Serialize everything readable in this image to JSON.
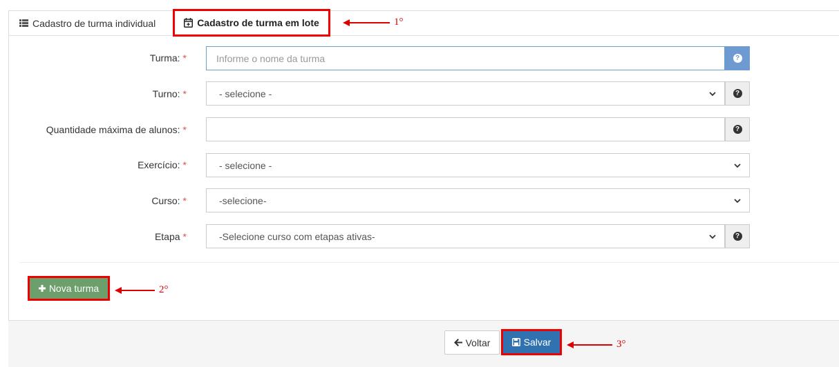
{
  "tabs": [
    {
      "label": "Cadastro de turma individual",
      "icon": "list-icon"
    },
    {
      "label": "Cadastro de turma em lote",
      "icon": "calendar-plus-icon"
    }
  ],
  "form": {
    "turma": {
      "label": "Turma:",
      "placeholder": "Informe o nome da turma"
    },
    "turno": {
      "label": "Turno:",
      "value": "- selecione -"
    },
    "quantidade": {
      "label": "Quantidade máxima de alunos:",
      "value": ""
    },
    "exercicio": {
      "label": "Exercício:",
      "value": "- selecione -"
    },
    "curso": {
      "label": "Curso:",
      "value": "-selecione-"
    },
    "etapa": {
      "label": "Etapa",
      "value": "-Selecione curso com etapas ativas-"
    },
    "required_mark": "*",
    "help_glyph": "?"
  },
  "buttons": {
    "nova_turma": "Nova turma",
    "voltar": "Voltar",
    "salvar": "Salvar"
  },
  "annotations": {
    "a1": "1°",
    "a2": "2°",
    "a3": "3°"
  },
  "colors": {
    "highlight": "#e00000",
    "success": "#6d9f6d",
    "primary": "#3071b0",
    "help_blue": "#6d9bd1",
    "required": "#d9534f"
  }
}
